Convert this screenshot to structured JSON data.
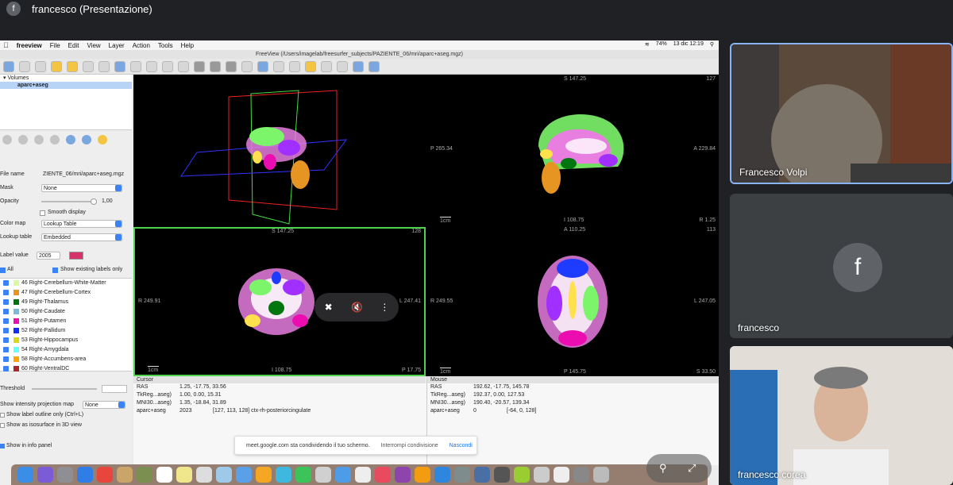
{
  "meet": {
    "avatar_letter": "f",
    "title": "francesco (Presentazione)"
  },
  "menubar": {
    "apple": "",
    "app": "freeview",
    "items": [
      "File",
      "Edit",
      "View",
      "Layer",
      "Action",
      "Tools",
      "Help"
    ],
    "battery": "74%",
    "datetime": "13 dic  12:19"
  },
  "window": {
    "title": "FreeView (/Users/imagelab/freesurfer_subjects/PAZIENTE_06/mri/aparc+aseg.mgz)"
  },
  "layers": {
    "group": "Volumes",
    "item": "aparc+aseg"
  },
  "props": {
    "file_name_label": "File name",
    "file_name_value": "ZIENTE_06/mri/aparc+aseg.mgz",
    "mask_label": "Mask",
    "mask_value": "None",
    "opacity_label": "Opacity",
    "opacity_value": "1,00",
    "smooth_label": "Smooth display",
    "colormap_label": "Color map",
    "colormap_value": "Lookup Table",
    "lookup_label": "Lookup table",
    "lookup_value": "Embedded",
    "label_value_label": "Label value",
    "label_value": "2005",
    "all_label": "All",
    "show_existing_label": "Show existing labels only",
    "threshold_label": "Threshold",
    "intensity_label": "Show intensity projection map",
    "intensity_value": "None",
    "outline_label": "Show label outline only (Ctrl+L)",
    "isosurface_label": "Show as isosurface in 3D view",
    "info_panel_label": "Show in info panel"
  },
  "labels": [
    {
      "text": "46 Right-Cerebellum-White-Matter",
      "color": "#dcf8a4"
    },
    {
      "text": "47 Right-Cerebellum-Cortex",
      "color": "#e69422"
    },
    {
      "text": "49 Right-Thalamus",
      "color": "#00760e"
    },
    {
      "text": "50 Right-Caudate",
      "color": "#7abadc"
    },
    {
      "text": "51 Right-Putamen",
      "color": "#ec0db0"
    },
    {
      "text": "52 Right-Pallidum",
      "color": "#0d30ff"
    },
    {
      "text": "53 Right-Hippocampus",
      "color": "#dcd814"
    },
    {
      "text": "54 Right-Amygdala",
      "color": "#67ffff"
    },
    {
      "text": "58 Right-Accumbens-area",
      "color": "#ffa500"
    },
    {
      "text": "60 Right-VentralDC",
      "color": "#a52a2a"
    }
  ],
  "views": {
    "sag": {
      "top": "S 147.25",
      "corner": "127",
      "left": "P 265.34",
      "right": "A 229.84",
      "bottom": "I 108.75",
      "br": "R 1.25",
      "scale": "1cm"
    },
    "cor": {
      "top": "S 147.25",
      "corner": "128",
      "left": "R 249.91",
      "right": "L 247.41",
      "bottom": "I 108.75",
      "br": "P 17.75",
      "scale": "1cm"
    },
    "axi": {
      "top": "A 110.25",
      "corner": "113",
      "left": "R 249.55",
      "right": "L 247.05",
      "bottom": "P 145.75",
      "br": "S 33.50",
      "scale": "1cm"
    }
  },
  "info": {
    "cursor_head": "Cursor",
    "mouse_head": "Mouse",
    "cursor": [
      {
        "k": "RAS",
        "v": "1.25, -17.75, 33.56",
        "extra": ""
      },
      {
        "k": "TkReg...aseg)",
        "v": "1.00, 0.00, 15.31",
        "extra": ""
      },
      {
        "k": "MNI30...aseg)",
        "v": "1.35, -18.84, 31.89",
        "extra": ""
      },
      {
        "k": "aparc+aseg",
        "v": "2023",
        "extra": "[127, 113, 128]  ctx-rh-posteriorcingulate"
      }
    ],
    "mouse": [
      {
        "k": "RAS",
        "v": "192.62, -17.75, 145.78",
        "extra": ""
      },
      {
        "k": "TkReg...aseg)",
        "v": "192.37, 0.00, 127.53",
        "extra": ""
      },
      {
        "k": "MNI30...aseg)",
        "v": "190.40, -20.57, 139.34",
        "extra": ""
      },
      {
        "k": "aparc+aseg",
        "v": "0",
        "extra": "[-64, 0, 128]"
      }
    ]
  },
  "share": {
    "text": "meet.google.com sta condividendo il tuo schermo.",
    "stop": "Interrompi condivisione",
    "hide": "Nascondi"
  },
  "participants": [
    {
      "name": "Francesco Volpi"
    },
    {
      "name": "francesco",
      "avatar": "f"
    },
    {
      "name": "francesco corea"
    }
  ]
}
